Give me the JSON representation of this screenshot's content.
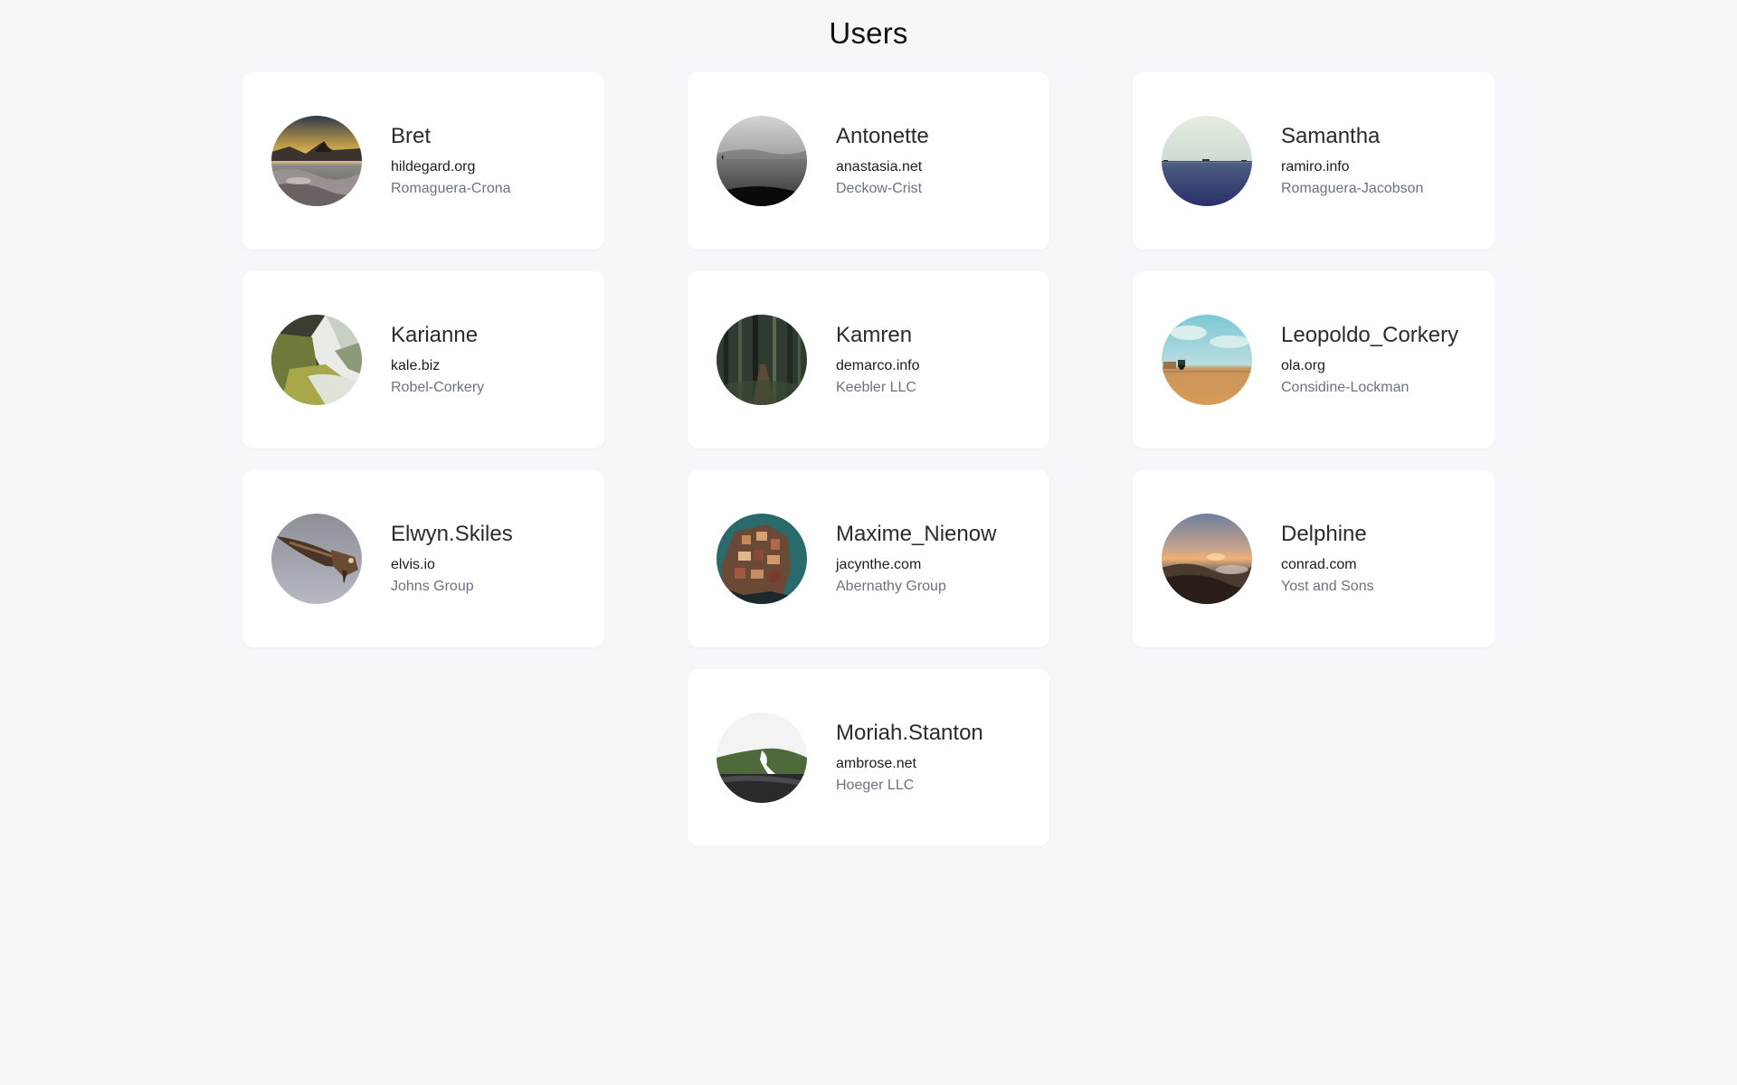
{
  "page": {
    "title": "Users",
    "background": "#f6f7fb"
  },
  "users": [
    {
      "username": "Bret",
      "website": "hildegard.org",
      "company": "Romaguera-Crona",
      "avatar": "rocky-sunset-seashore-photo"
    },
    {
      "username": "Antonette",
      "website": "anastasia.net",
      "company": "Deckow-Crist",
      "avatar": "monochrome-sea-photo"
    },
    {
      "username": "Samantha",
      "website": "ramiro.info",
      "company": "Romaguera-Jacobson",
      "avatar": "calm-ocean-horizon-photo"
    },
    {
      "username": "Karianne",
      "website": "kale.biz",
      "company": "Robel-Corkery",
      "avatar": "coastal-cliff-beach-photo"
    },
    {
      "username": "Kamren",
      "website": "demarco.info",
      "company": "Keebler LLC",
      "avatar": "forest-path-photo"
    },
    {
      "username": "Leopoldo_Corkery",
      "website": "ola.org",
      "company": "Considine-Lockman",
      "avatar": "farm-field-sky-photo"
    },
    {
      "username": "Elwyn.Skiles",
      "website": "elvis.io",
      "company": "Johns Group",
      "avatar": "eagle-in-flight-photo"
    },
    {
      "username": "Maxime_Nienow",
      "website": "jacynthe.com",
      "company": "Abernathy Group",
      "avatar": "cliffside-village-photo"
    },
    {
      "username": "Delphine",
      "website": "conrad.com",
      "company": "Yost and Sons",
      "avatar": "misty-mountain-sunrise-photo"
    },
    {
      "username": "Moriah.Stanton",
      "website": "ambrose.net",
      "company": "Hoeger LLC",
      "avatar": "green-snowy-mountain-photo"
    }
  ],
  "colors": {
    "card": "#ffffff",
    "username": "#2b2b2b",
    "website": "#1d1d1d",
    "company": "#6b7380"
  }
}
